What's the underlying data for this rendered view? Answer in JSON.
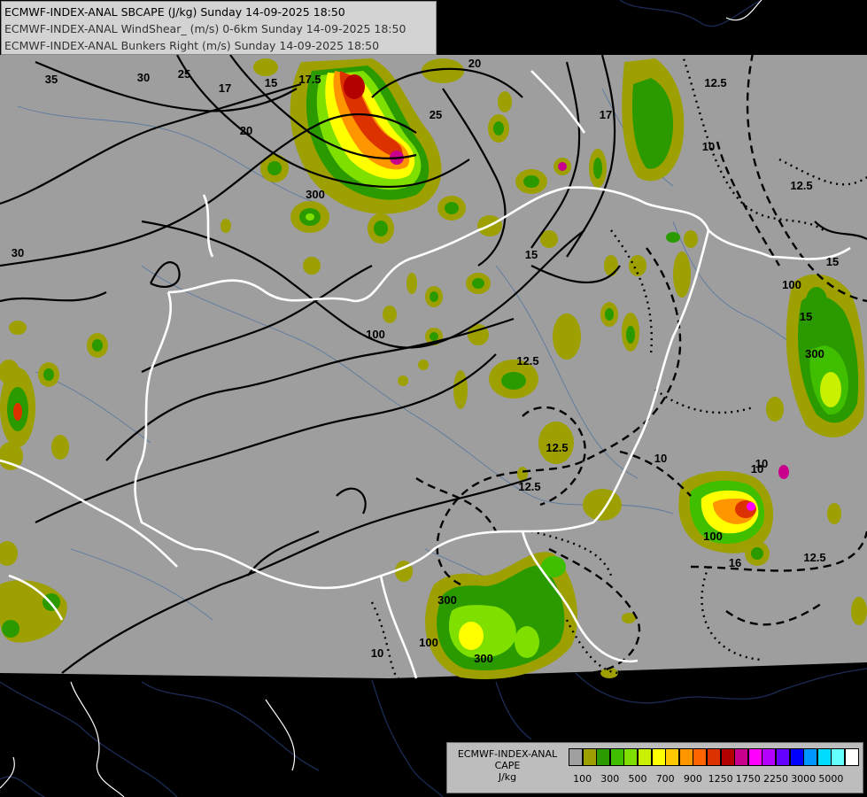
{
  "header": {
    "line1": "ECMWF-INDEX-ANAL SBCAPE (J/kg) Sunday 14-09-2025 18:50",
    "line2": "ECMWF-INDEX-ANAL WindShear_ (m/s) 0-6km Sunday 14-09-2025 18:50",
    "line3": "ECMWF-INDEX-ANAL Bunkers Right (m/s) Sunday 14-09-2025 18:50"
  },
  "legend": {
    "title1": "ECMWF-INDEX-ANAL",
    "title2": "CAPE",
    "title3": "J/kg",
    "colors": [
      "#a0a0a0",
      "#9da000",
      "#2a9a00",
      "#3fbf00",
      "#7fe000",
      "#c8f000",
      "#ffff00",
      "#ffc800",
      "#ff9600",
      "#ff6400",
      "#dc3200",
      "#b40000",
      "#c8008c",
      "#ff00ff",
      "#b400ff",
      "#6400ff",
      "#0000ff",
      "#0096ff",
      "#00dcff",
      "#64ffff",
      "#ffffff"
    ],
    "tick_labels": [
      "100",
      "300",
      "500",
      "700",
      "900",
      "1250",
      "1750",
      "2250",
      "3000",
      "5000"
    ]
  },
  "contour_labels": [
    {
      "text": "35"
    },
    {
      "text": "30"
    },
    {
      "text": "25"
    },
    {
      "text": "20"
    },
    {
      "text": "17"
    },
    {
      "text": "15"
    },
    {
      "text": "17.5"
    },
    {
      "text": "25"
    },
    {
      "text": "20"
    },
    {
      "text": "30"
    },
    {
      "text": "12.5"
    },
    {
      "text": "10"
    },
    {
      "text": "12.5"
    },
    {
      "text": "12.5"
    },
    {
      "text": "10"
    },
    {
      "text": "12.5"
    },
    {
      "text": "12.5"
    },
    {
      "text": "10"
    },
    {
      "text": "15"
    },
    {
      "text": "16"
    },
    {
      "text": "12.5"
    },
    {
      "text": "10"
    },
    {
      "text": "100"
    },
    {
      "text": "300"
    },
    {
      "text": "300"
    },
    {
      "text": "100"
    },
    {
      "text": "300"
    },
    {
      "text": "300"
    },
    {
      "text": "100"
    },
    {
      "text": "100"
    },
    {
      "text": "17"
    },
    {
      "text": "15"
    },
    {
      "text": "15"
    },
    {
      "text": "10"
    }
  ]
}
